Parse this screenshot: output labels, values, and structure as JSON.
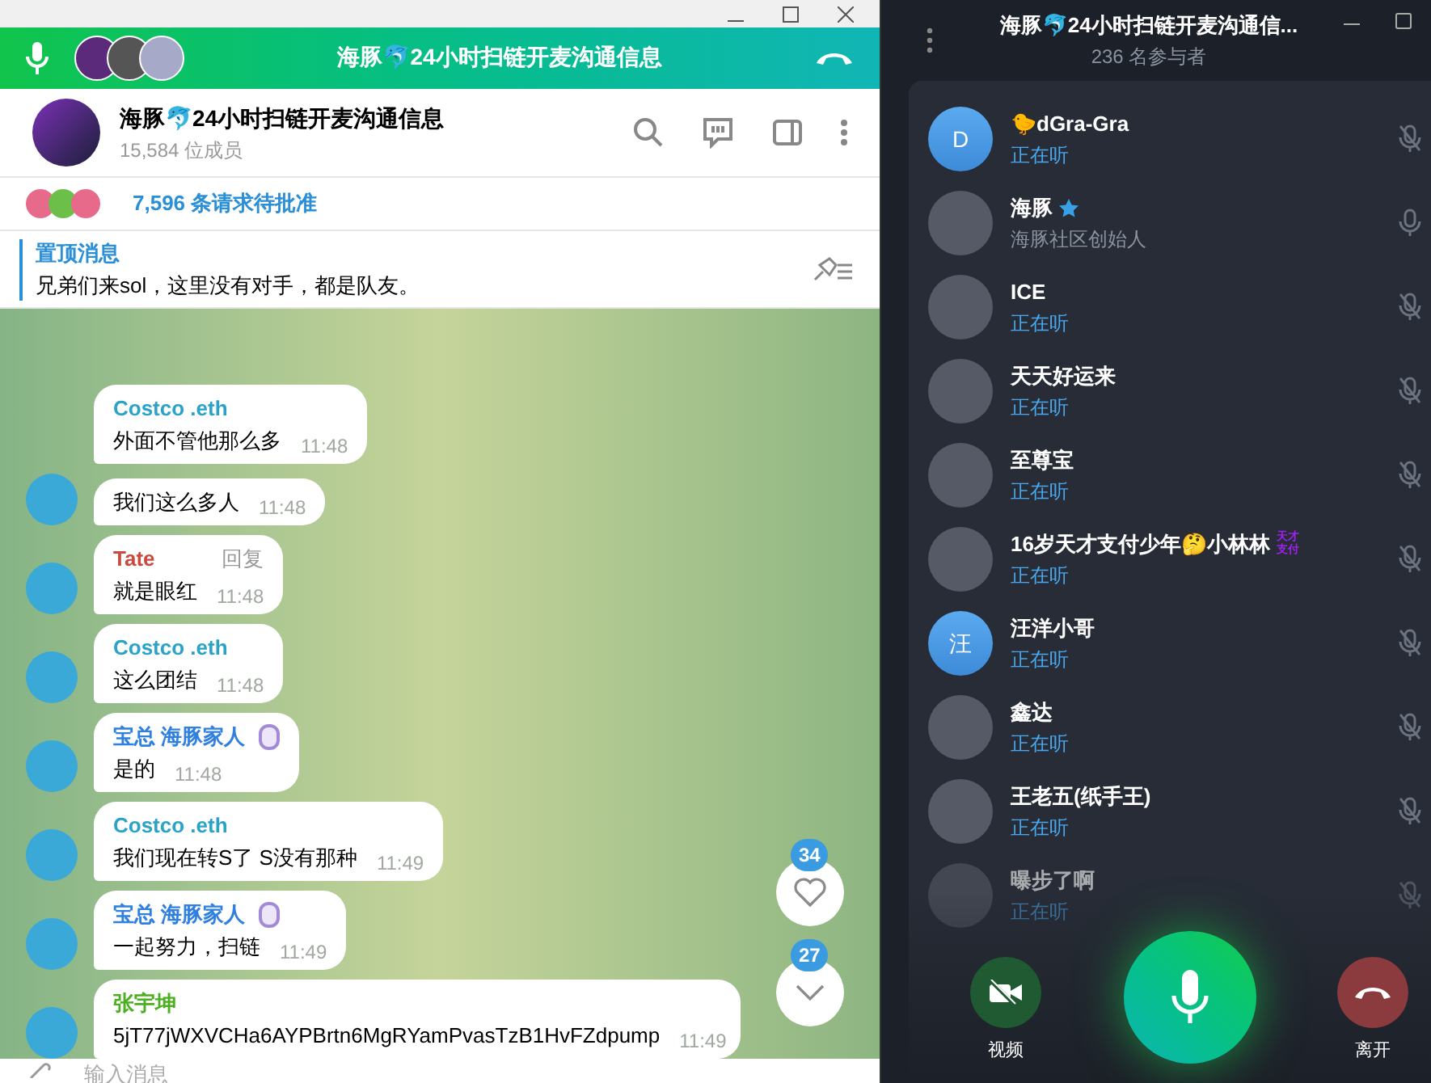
{
  "call_bar": {
    "title": "海豚🐬24小时扫链开麦沟通信息"
  },
  "chat_header": {
    "title": "海豚🐬24小时扫链开麦沟通信息",
    "subtitle": "15,584 位成员"
  },
  "join_requests": {
    "text": "7,596 条请求待批准"
  },
  "pinned": {
    "label": "置顶消息",
    "text": "兄弟们来sol，这里没有对手，都是队友。"
  },
  "messages": [
    {
      "sender": "Costco .eth",
      "color": "#2ba3c9",
      "text": "外面不管他那么多",
      "time": "11:48",
      "avatar": false
    },
    {
      "text": "我们这么多人",
      "time": "11:48",
      "avatar": true
    },
    {
      "sender": "Tate",
      "color": "#c94b3f",
      "reply": "回复",
      "text": "就是眼红",
      "time": "11:48",
      "avatar": true
    },
    {
      "sender": "Costco .eth",
      "color": "#2ba3c9",
      "text": "这么团结",
      "time": "11:48",
      "avatar": true
    },
    {
      "sender": "宝总 海豚家人",
      "color": "#2f80e0",
      "badge": true,
      "text": "是的",
      "time": "11:48",
      "avatar": true
    },
    {
      "sender": "Costco .eth",
      "color": "#2ba3c9",
      "text": "我们现在转S了 S没有那种",
      "time": "11:49",
      "avatar": true
    },
    {
      "sender": "宝总 海豚家人",
      "color": "#2f80e0",
      "badge": true,
      "text": "一起努力，扫链",
      "time": "11:49",
      "avatar": true
    },
    {
      "sender": "张宇坤",
      "color": "#4caf1f",
      "text": "5jT77jWXVCHa6AYPBrtn6MgRYamPvasTzB1HvFZdpump",
      "time": "11:49",
      "avatar": true
    }
  ],
  "reactions_count": "34",
  "unread_count": "27",
  "composer": {
    "placeholder": "输入消息"
  },
  "voice_chat": {
    "title": "海豚🐬24小时扫链开麦沟通信...",
    "subtitle": "236 名参与者",
    "participants": [
      {
        "name": "🐤dGra-Gra",
        "status": "正在听",
        "letter": "D",
        "muted": true,
        "faded": false
      },
      {
        "name": "海豚",
        "star": true,
        "status": "海豚社区创始人",
        "muted": false,
        "faded": false
      },
      {
        "name": "ICE",
        "status": "正在听",
        "muted": true,
        "faded": false
      },
      {
        "name": "天天好运来",
        "status": "正在听",
        "muted": true,
        "faded": false
      },
      {
        "name": "至尊宝",
        "status": "正在听",
        "muted": true,
        "faded": false
      },
      {
        "name": "16岁天才支付少年🤔小林林",
        "tag": "天才支付",
        "status": "正在听",
        "muted": true,
        "faded": false
      },
      {
        "name": "汪洋小哥",
        "status": "正在听",
        "letter": "汪",
        "muted": true,
        "faded": false
      },
      {
        "name": "鑫达",
        "status": "正在听",
        "muted": true,
        "faded": false
      },
      {
        "name": "王老五(纸手王)",
        "status": "正在听",
        "muted": true,
        "faded": false
      },
      {
        "name": "曝步了啊",
        "status": "正在听",
        "muted": true,
        "faded": true
      }
    ],
    "video_label": "视频",
    "leave_label": "离开"
  }
}
